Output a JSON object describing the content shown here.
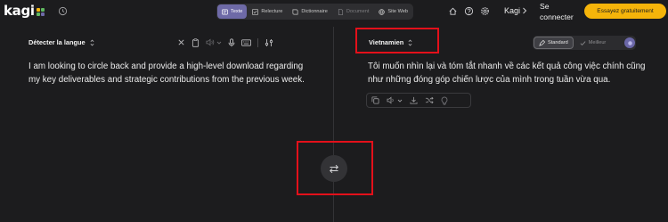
{
  "header": {
    "logo_text": "kagi",
    "modes": [
      {
        "label": "Texte",
        "icon": "text-icon",
        "active": true
      },
      {
        "label": "Relecture",
        "icon": "proofread-icon"
      },
      {
        "label": "Dictionnaire",
        "icon": "book-icon"
      },
      {
        "label": "Document",
        "icon": "document-icon"
      },
      {
        "label": "Site Web",
        "icon": "globe-icon"
      }
    ],
    "kagi_link": "Kagi",
    "signin_line1": "Se",
    "signin_line2": "connecter",
    "cta": "Essayez gratuitement"
  },
  "source": {
    "language": "Détecter la langue",
    "text": "I am looking to circle back and provide a high-level download regarding my key deliverables and strategic contributions from the previous week."
  },
  "target": {
    "language": "Vietnamien",
    "text": "Tôi muốn nhìn lại và tóm tắt nhanh về các kết quả công việc chính cũng như những đóng góp chiến lược của mình trong tuần vừa qua.",
    "quality_options": [
      "Standard",
      "Meilleur"
    ],
    "quality_selected": "Standard"
  },
  "colors": {
    "background": "#1c1c1e",
    "accent": "#6e6aa7",
    "cta": "#f5b40a",
    "highlight": "#e3101a"
  }
}
